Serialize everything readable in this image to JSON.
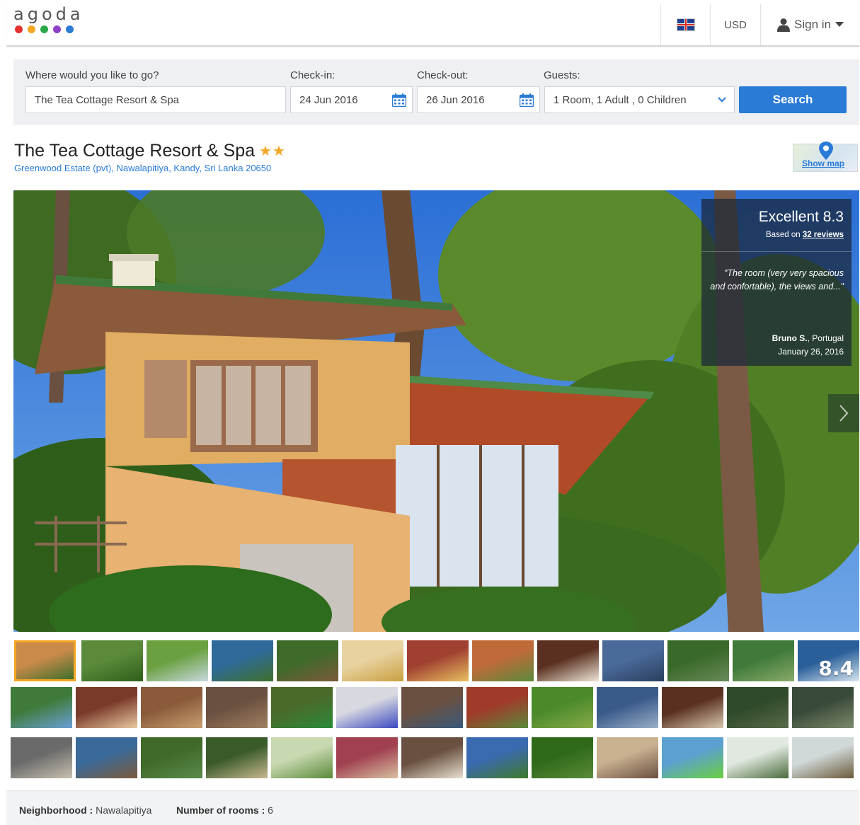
{
  "header": {
    "logo_text": "agoda",
    "logo_dot_colors": [
      "#e62f2f",
      "#f5a623",
      "#2ba84a",
      "#8b3fc9",
      "#2a7bd6"
    ],
    "flag_icon": "uk-flag-icon",
    "currency": "USD",
    "signin_label": "Sign in"
  },
  "search": {
    "destination_label": "Where would you like to go?",
    "destination_value": "The Tea Cottage Resort & Spa",
    "checkin_label": "Check-in:",
    "checkin_value": "24 Jun 2016",
    "checkout_label": "Check-out:",
    "checkout_value": "26 Jun 2016",
    "guests_label": "Guests:",
    "guests_value": "1 Room, 1 Adult , 0 Children",
    "search_button": "Search"
  },
  "hotel": {
    "name": "The Tea Cottage Resort & Spa",
    "stars": "★★",
    "star_count": 2,
    "address": "Greenwood Estate (pvt), Nawalapitiya, Kandy, Sri Lanka 20650",
    "show_map_label": "Show map"
  },
  "review": {
    "score_text": "Excellent 8.3",
    "based_on_prefix": "Based on ",
    "reviews_link": "32 reviews",
    "quote": "\"The room (very very spacious and confortable), the views and...\"",
    "author_name": "Bruno S.",
    "author_country": ", Portugal",
    "date": "January 26, 2016"
  },
  "gallery": {
    "active_index": 0,
    "score_badge": "8.4",
    "thumb_count": 39
  },
  "info": {
    "neighborhood_label": "Neighborhood :",
    "neighborhood_value": " Nawalapitiya",
    "rooms_label": "Number of rooms :",
    "rooms_value": " 6"
  },
  "colors": {
    "accent_blue": "#2a7bd6",
    "star_orange": "#f5a623",
    "active_thumb_border": "#f5a623"
  }
}
